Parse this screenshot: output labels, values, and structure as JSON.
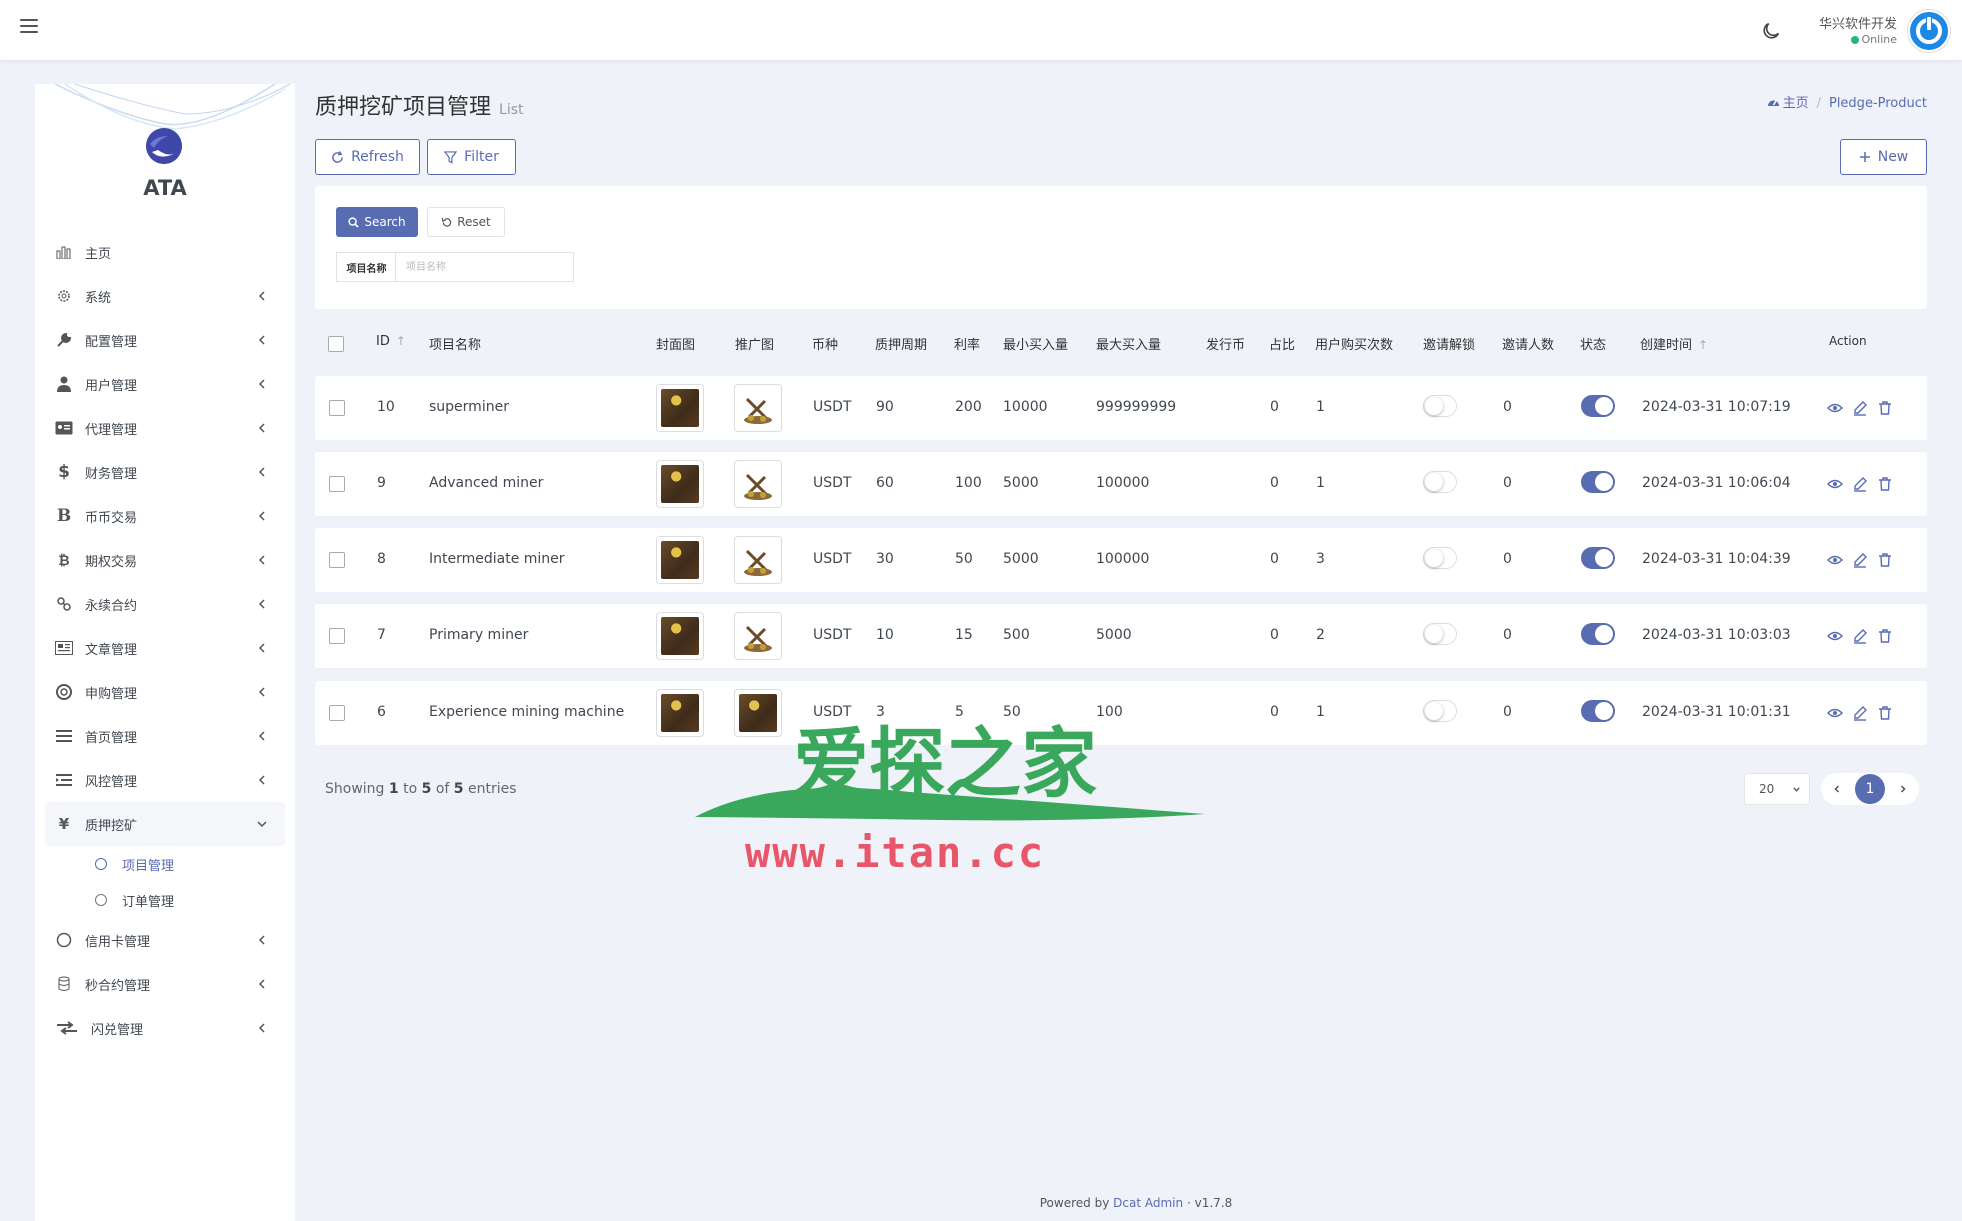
{
  "topbar": {
    "user_name": "华兴软件开发",
    "user_status": "Online"
  },
  "sidebar": {
    "brand": "ATA",
    "items": [
      {
        "label": "主页",
        "icon": "bar-chart-icon",
        "chevron": false
      },
      {
        "label": "系统",
        "icon": "gear-icon",
        "chevron": true
      },
      {
        "label": "配置管理",
        "icon": "wrench-icon",
        "chevron": true
      },
      {
        "label": "用户管理",
        "icon": "user-tie-icon",
        "chevron": true
      },
      {
        "label": "代理管理",
        "icon": "id-card-icon",
        "chevron": true
      },
      {
        "label": "财务管理",
        "icon": "dollar-icon",
        "chevron": true
      },
      {
        "label": "币币交易",
        "icon": "bitcoin-b-icon",
        "chevron": true
      },
      {
        "label": "期权交易",
        "icon": "bitcoin-icon",
        "chevron": true
      },
      {
        "label": "永续合约",
        "icon": "link-icon",
        "chevron": true
      },
      {
        "label": "文章管理",
        "icon": "newspaper-icon",
        "chevron": true
      },
      {
        "label": "申购管理",
        "icon": "lifebuoy-icon",
        "chevron": true
      },
      {
        "label": "首页管理",
        "icon": "list-icon",
        "chevron": true
      },
      {
        "label": "风控管理",
        "icon": "indent-icon",
        "chevron": true
      }
    ],
    "active_item": {
      "label": "质押挖矿",
      "icon": "yen-icon"
    },
    "sub_items": [
      {
        "label": "项目管理",
        "active": true
      },
      {
        "label": "订单管理",
        "active": false
      }
    ],
    "after_items": [
      {
        "label": "信用卡管理",
        "icon": "circle-icon"
      },
      {
        "label": "秒合约管理",
        "icon": "coins-icon"
      },
      {
        "label": "闪兑管理",
        "icon": "exchange-icon"
      }
    ]
  },
  "page": {
    "title": "质押挖矿项目管理",
    "subtitle": "List",
    "breadcrumb_home": "主页",
    "breadcrumb_current": "Pledge-Product"
  },
  "toolbar": {
    "refresh": "Refresh",
    "filter": "Filter",
    "new": "New"
  },
  "filter": {
    "search": "Search",
    "reset": "Reset",
    "field_label": "项目名称",
    "field_placeholder": "项目名称",
    "field_value": ""
  },
  "table": {
    "headers": [
      "ID",
      "项目名称",
      "封面图",
      "推广图",
      "币种",
      "质押周期",
      "利率",
      "最小买入量",
      "最大买入量",
      "发行币",
      "占比",
      "用户购买次数",
      "邀请解锁",
      "邀请人数",
      "状态",
      "创建时间",
      "Action"
    ],
    "rows": [
      {
        "id": "10",
        "name": "superminer",
        "coin": "USDT",
        "cycle": "90",
        "rate": "200",
        "min": "10000",
        "max": "999999999",
        "issue": "",
        "ratio": "0",
        "buys": "1",
        "invite_unlock": false,
        "invites": "0",
        "status": true,
        "created": "2024-03-31 10:07:19"
      },
      {
        "id": "9",
        "name": "Advanced miner",
        "coin": "USDT",
        "cycle": "60",
        "rate": "100",
        "min": "5000",
        "max": "100000",
        "issue": "",
        "ratio": "0",
        "buys": "1",
        "invite_unlock": false,
        "invites": "0",
        "status": true,
        "created": "2024-03-31 10:06:04"
      },
      {
        "id": "8",
        "name": "Intermediate miner",
        "coin": "USDT",
        "cycle": "30",
        "rate": "50",
        "min": "5000",
        "max": "100000",
        "issue": "",
        "ratio": "0",
        "buys": "3",
        "invite_unlock": false,
        "invites": "0",
        "status": true,
        "created": "2024-03-31 10:04:39"
      },
      {
        "id": "7",
        "name": "Primary miner",
        "coin": "USDT",
        "cycle": "10",
        "rate": "15",
        "min": "500",
        "max": "5000",
        "issue": "",
        "ratio": "0",
        "buys": "2",
        "invite_unlock": false,
        "invites": "0",
        "status": true,
        "created": "2024-03-31 10:03:03"
      },
      {
        "id": "6",
        "name": "Experience mining machine",
        "coin": "USDT",
        "cycle": "3",
        "rate": "5",
        "min": "50",
        "max": "100",
        "issue": "",
        "ratio": "0",
        "buys": "1",
        "invite_unlock": false,
        "invites": "0",
        "status": true,
        "created": "2024-03-31 10:01:31"
      }
    ]
  },
  "pagination": {
    "showing_prefix": "Showing",
    "from": "1",
    "to_word": "to",
    "to": "5",
    "of_word": "of",
    "total": "5",
    "entries_word": "entries",
    "per_page": "20",
    "current_page": "1"
  },
  "watermark": {
    "text": "爱探之家",
    "url": "www.itan.cc"
  },
  "footer": {
    "powered": "Powered by",
    "link": "Dcat Admin",
    "dot": "·",
    "version": "v1.7.8"
  },
  "colors": {
    "primary": "#586cb1",
    "online": "#21b978",
    "watermark_green": "#3aa85c",
    "watermark_red": "#e8566a"
  }
}
